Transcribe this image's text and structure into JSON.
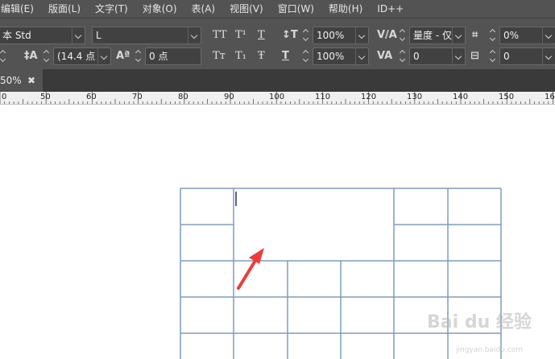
{
  "menu": [
    "编辑(E)",
    "版面(L)",
    "文字(T)",
    "对象(O)",
    "表(A)",
    "视图(V)",
    "窗口(W)",
    "帮助(H)",
    "ID++"
  ],
  "control": {
    "font_family": "本 Std",
    "font_style": "L",
    "case_buttons_row1": [
      "TT",
      "T¹",
      "T"
    ],
    "case_buttons_row2": [
      "Tт",
      "T₁",
      "Ŧ"
    ],
    "vertical_scale": "100%",
    "horizontal_scale": "100%",
    "kerning": "量度 - 仅",
    "tracking": "0",
    "baseline_shift": "0 点",
    "leading": "(14.4 点",
    "skew": "0°",
    "tsume": "0%",
    "grid": "0"
  },
  "document_tab": {
    "label": "50%",
    "close": "✖"
  },
  "ruler_labels": [
    "0",
    "50",
    "60",
    "70",
    "80",
    "90",
    "100",
    "110",
    "120",
    "130",
    "140",
    "150",
    "160"
  ],
  "watermark": {
    "main": "Bai du 经验",
    "sub": "jingyan.baidu.com"
  },
  "colors": {
    "ui_panel": "#535353",
    "table_line": "#7f9bbf",
    "arrow": "#ee3b3b"
  }
}
